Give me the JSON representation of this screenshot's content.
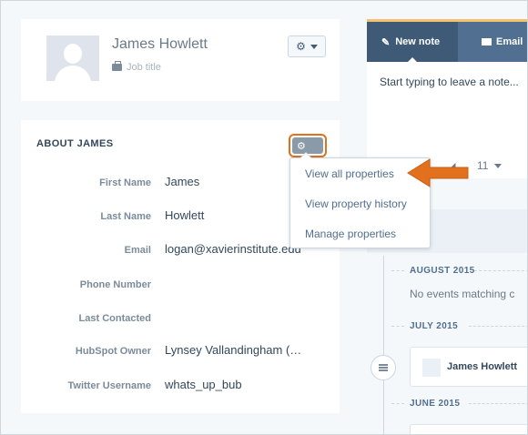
{
  "profile": {
    "name": "James Howlett",
    "job_title": "Job title",
    "settings_icon": "gear-icon"
  },
  "about": {
    "title": "ABOUT JAMES",
    "settings_icon": "gear-icon",
    "properties": [
      {
        "label": "First Name",
        "value": "James"
      },
      {
        "label": "Last Name",
        "value": "Howlett"
      },
      {
        "label": "Email",
        "value": "logan@xavierinstitute.edu"
      },
      {
        "label": "Phone Number",
        "value": ""
      },
      {
        "label": "Last Contacted",
        "value": ""
      },
      {
        "label": "HubSpot Owner",
        "value": "Lynsey Vallandingham (…"
      },
      {
        "label": "Twitter Username",
        "value": "whats_up_bub"
      }
    ]
  },
  "dropdown": {
    "items": [
      "View all properties",
      "View property history",
      "Manage properties"
    ]
  },
  "notes": {
    "tabs": [
      {
        "label": "New note",
        "icon": "pencil-square-icon"
      },
      {
        "label": "Email",
        "icon": "envelope-icon"
      }
    ],
    "placeholder": "Start typing to leave a note...",
    "font_size": "11"
  },
  "timeline": {
    "sections": [
      {
        "header": "AUGUST 2015",
        "text": "No events matching c"
      },
      {
        "header": "JULY 2015",
        "event_name": "James Howlett"
      },
      {
        "header": "JUNE 2015"
      }
    ]
  },
  "colors": {
    "accent_orange": "#e2711d",
    "tab_bar": "#516f90",
    "tab_active": "#3e5a76",
    "top_border": "#f5c26b"
  }
}
